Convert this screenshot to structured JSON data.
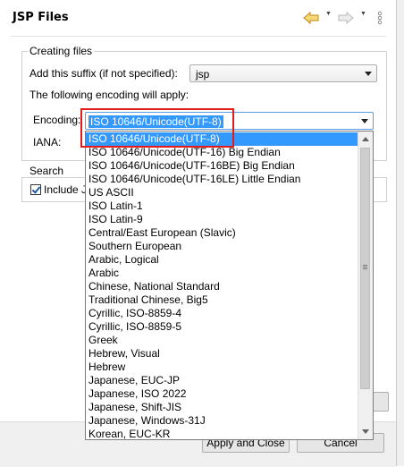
{
  "header": {
    "title": "JSP Files",
    "icons": [
      "back-arrow-icon",
      "dropdown-icon",
      "forward-arrow-icon",
      "dropdown-icon",
      "menu-kebab-icon"
    ]
  },
  "creating_files": {
    "group_label": "Creating files",
    "suffix_label": "Add this suffix (if not specified):",
    "suffix_value": "jsp",
    "encoding_note": "The following encoding will apply:",
    "encoding_label": "Encoding:",
    "encoding_value": "ISO 10646/Unicode(UTF-8)",
    "iana_label": "IANA:"
  },
  "search": {
    "group_label": "Search",
    "include_label": "Include J",
    "include_checked": true
  },
  "buttons": {
    "apply_close": "Apply and Close",
    "cancel": "Cancel"
  },
  "encoding_dropdown": {
    "selected_index": 0,
    "options": [
      "ISO 10646/Unicode(UTF-8)",
      "ISO 10646/Unicode(UTF-16) Big Endian",
      "ISO 10646/Unicode(UTF-16BE) Big Endian",
      "ISO 10646/Unicode(UTF-16LE) Little Endian",
      "US ASCII",
      "ISO Latin-1",
      "ISO Latin-9",
      "Central/East European (Slavic)",
      "Southern European",
      "Arabic, Logical",
      "Arabic",
      "Chinese, National Standard",
      "Traditional Chinese, Big5",
      "Cyrillic, ISO-8859-4",
      "Cyrillic, ISO-8859-5",
      "Greek",
      "Hebrew, Visual",
      "Hebrew",
      "Japanese, EUC-JP",
      "Japanese, ISO 2022",
      "Japanese, Shift-JIS",
      "Japanese, Windows-31J",
      "Korean, EUC-KR"
    ]
  },
  "colors": {
    "selection": "#3399ff",
    "highlight_box": "#e21b1b",
    "back_arrow": "#e8b53a"
  }
}
